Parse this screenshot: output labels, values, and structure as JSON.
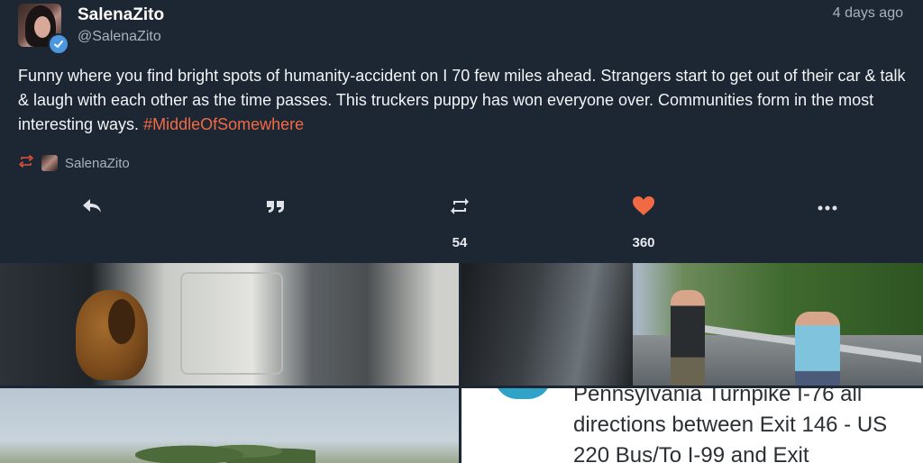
{
  "tweet": {
    "display_name": "SalenaZito",
    "handle": "@SalenaZito",
    "timestamp": "4 days ago",
    "text": "Funny where you find bright spots of humanity-accident on I 70 few miles ahead. Strangers start to get out of their car & talk & laugh with each other as the time passes. This truckers puppy has won everyone over. Communities form in the most interesting ways. ",
    "hashtag": "#MiddleOfSomewhere",
    "retweeted_by": "SalenaZito",
    "verified": true
  },
  "actions": {
    "reply_icon": "reply-icon",
    "quote_icon": "quote-icon",
    "retweet_icon": "retweet-icon",
    "like_icon": "heart-icon",
    "more_icon": "more-icon",
    "retweet_count": "54",
    "like_count": "360"
  },
  "media": {
    "alert_text": "Pennsylvania Turnpike I-76 all directions between Exit 146 - US 220 Bus/To I-99 and Exit"
  },
  "colors": {
    "background": "#1d2633",
    "hashtag": "#f26a44",
    "like": "#f26a44",
    "retweet_small": "#e0533d",
    "verified": "#4a97e0",
    "muted_text": "#a8b2bf"
  }
}
